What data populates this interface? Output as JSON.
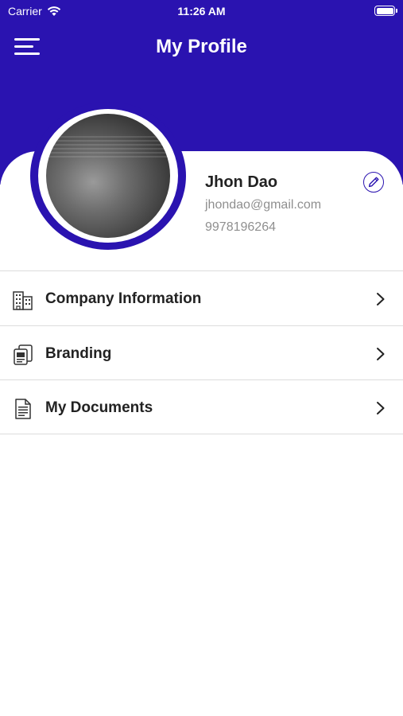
{
  "status_bar": {
    "carrier": "Carrier",
    "time": "11:26 AM",
    "wifi_icon": "wifi-icon",
    "battery_icon": "battery-full-icon"
  },
  "nav": {
    "title": "My Profile",
    "menu_icon": "hamburger-menu-icon"
  },
  "profile": {
    "name": "Jhon Dao",
    "email": "jhondao@gmail.com",
    "phone": "9978196264",
    "edit_icon": "pencil-icon"
  },
  "menu_items": [
    {
      "label": "Company Information",
      "icon": "building-icon"
    },
    {
      "label": "Branding",
      "icon": "copy-cards-icon"
    },
    {
      "label": "My Documents",
      "icon": "document-icon"
    }
  ],
  "colors": {
    "brand": "#2a13b0",
    "background": "#ffffff",
    "text_primary": "#222222",
    "text_secondary": "#8f8f8f",
    "divider": "#dcdcdc"
  }
}
